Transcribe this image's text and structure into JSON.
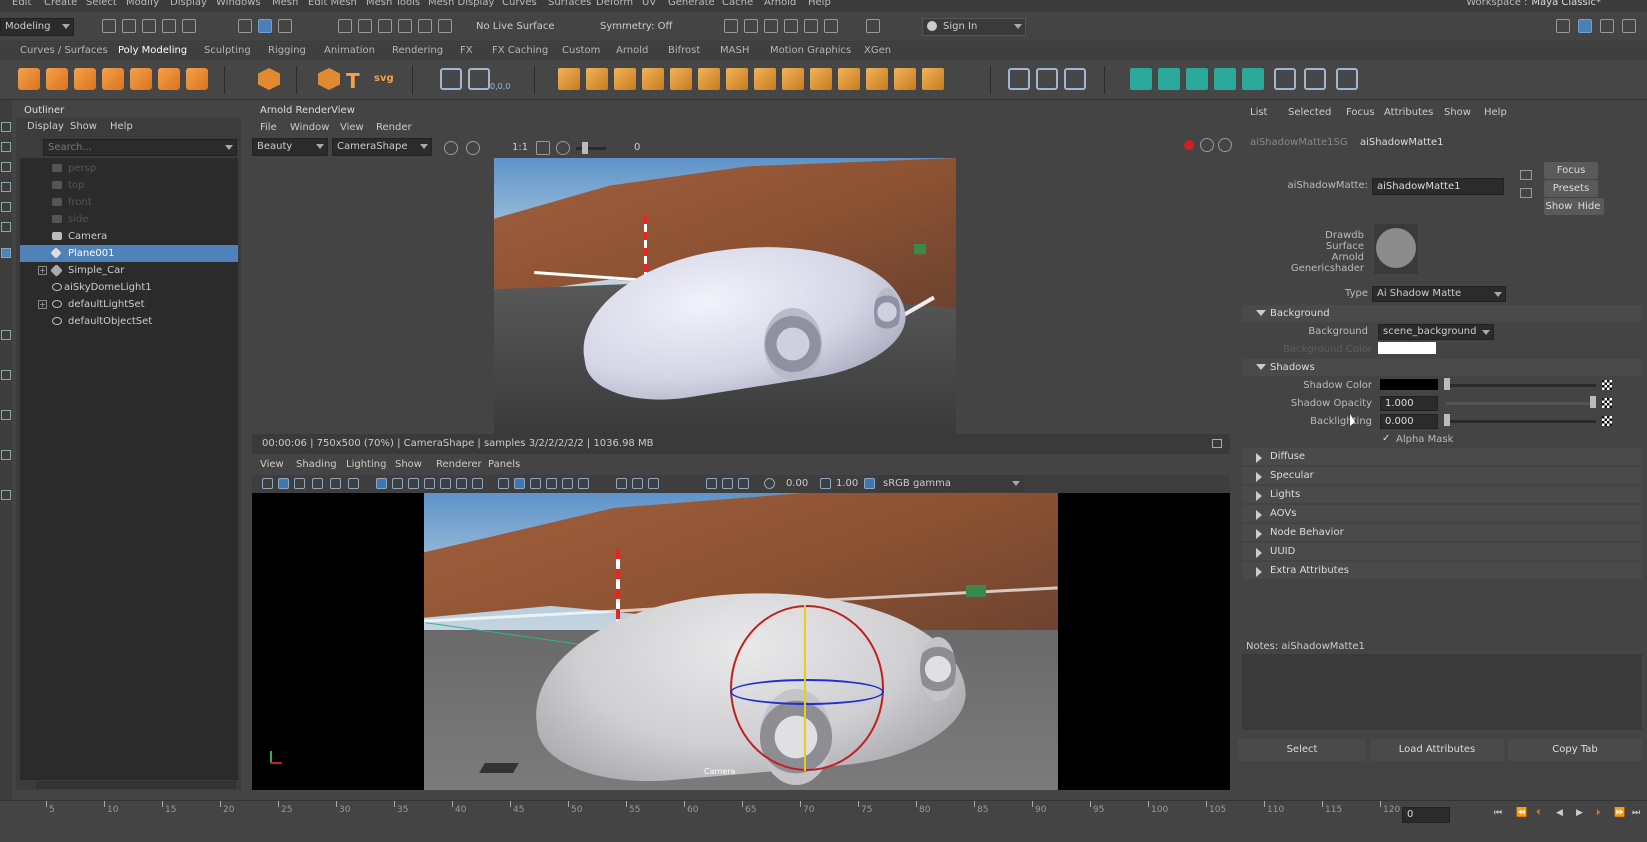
{
  "menubar": {
    "items": [
      "Edit",
      "Create",
      "Select",
      "Modify",
      "Display",
      "Windows",
      "Mesh",
      "Edit Mesh",
      "Mesh Tools",
      "Mesh Display",
      "Curves",
      "Surfaces",
      "Deform",
      "UV",
      "Generate",
      "Cache",
      "Arnold",
      "Help"
    ],
    "workspace_label": "Workspace :",
    "workspace_value": "Maya Classic*"
  },
  "statusline": {
    "menuset": "Modeling",
    "live_surface": "No Live Surface",
    "symmetry": "Symmetry: Off",
    "sign_in": "Sign In"
  },
  "shelf": {
    "tabs": [
      "Curves / Surfaces",
      "Poly Modeling",
      "Sculpting",
      "Rigging",
      "Animation",
      "Rendering",
      "FX",
      "FX Caching",
      "Custom",
      "Arnold",
      "Bifrost",
      "MASH",
      "Motion Graphics",
      "XGen"
    ],
    "active_tab": "Poly Modeling",
    "text_tool_label": "T",
    "svg_tool_label": "svg",
    "poly_count_label": "0,0,0"
  },
  "outliner": {
    "title": "Outliner",
    "menu": [
      "Display",
      "Show",
      "Help"
    ],
    "search_placeholder": "Search...",
    "items": [
      {
        "label": "persp",
        "dim": true
      },
      {
        "label": "top",
        "dim": true
      },
      {
        "label": "front",
        "dim": true
      },
      {
        "label": "side",
        "dim": true
      },
      {
        "label": "Camera",
        "dim": false
      },
      {
        "label": "Plane001",
        "dim": false,
        "selected": true
      },
      {
        "label": "Simple_Car",
        "dim": false,
        "expandable": true
      },
      {
        "label": "aiSkyDomeLight1",
        "dim": false
      },
      {
        "label": "defaultLightSet",
        "dim": false,
        "expandable": true
      },
      {
        "label": "defaultObjectSet",
        "dim": false
      }
    ]
  },
  "renderview": {
    "title": "Arnold RenderView",
    "menu": [
      "File",
      "Window",
      "View",
      "Render"
    ],
    "aov": "Beauty",
    "camera": "CameraShape",
    "ratio": "1:1",
    "exposure": "0",
    "status": "00:00:06 | 750x500 (70%) | CameraShape | samples 3/2/2/2/2/2 | 1036.98 MB"
  },
  "viewport": {
    "menu": [
      "View",
      "Shading",
      "Lighting",
      "Show",
      "Renderer",
      "Panels"
    ],
    "value_a": "0.00",
    "value_b": "1.00",
    "color_space": "sRGB gamma",
    "camera_label": "Camera"
  },
  "attribute_editor": {
    "menu": [
      "List",
      "Selected",
      "Focus",
      "Attributes",
      "Show",
      "Help"
    ],
    "tabs": [
      "aiShadowMatte1SG",
      "aiShadowMatte1"
    ],
    "active_tab": "aiShadowMatte1",
    "node_label": "aiShadowMatte:",
    "node_name": "aiShadowMatte1",
    "focus_btn": "Focus",
    "presets_btn": "Presets",
    "show_btn": "Show",
    "hide_btn": "Hide",
    "swatch_label": [
      "Drawdb",
      "Surface",
      "Arnold",
      "Genericshader"
    ],
    "type_label": "Type",
    "type_value": "Ai Shadow Matte",
    "sections": {
      "background": "Background",
      "shadows": "Shadows",
      "collapsed": [
        "Diffuse",
        "Specular",
        "Lights",
        "AOVs",
        "Node Behavior",
        "UUID",
        "Extra Attributes"
      ]
    },
    "background_label": "Background",
    "background_value": "scene_background",
    "background_color_label": "Background Color",
    "shadow_color_label": "Shadow Color",
    "shadow_opacity_label": "Shadow Opacity",
    "shadow_opacity_value": "1.000",
    "backlighting_label": "Backlighting",
    "backlighting_value": "0.000",
    "alpha_mask_label": "Alpha Mask",
    "notes_label": "Notes:  aiShadowMatte1",
    "buttons": [
      "Select",
      "Load Attributes",
      "Copy Tab"
    ]
  },
  "timeslider": {
    "ticks": [
      "5",
      "10",
      "15",
      "20",
      "25",
      "30",
      "35",
      "40",
      "45",
      "50",
      "55",
      "60",
      "65",
      "70",
      "75",
      "80",
      "85",
      "90",
      "95",
      "100",
      "105",
      "110",
      "115",
      "120"
    ],
    "current_frame": "0"
  },
  "colors": {
    "selection": "#4f82b8",
    "accent_orange": "#f6a14a",
    "accent_teal": "#2aa89a",
    "gizmo_red": "#d02020",
    "gizmo_blue": "#2030d0"
  }
}
